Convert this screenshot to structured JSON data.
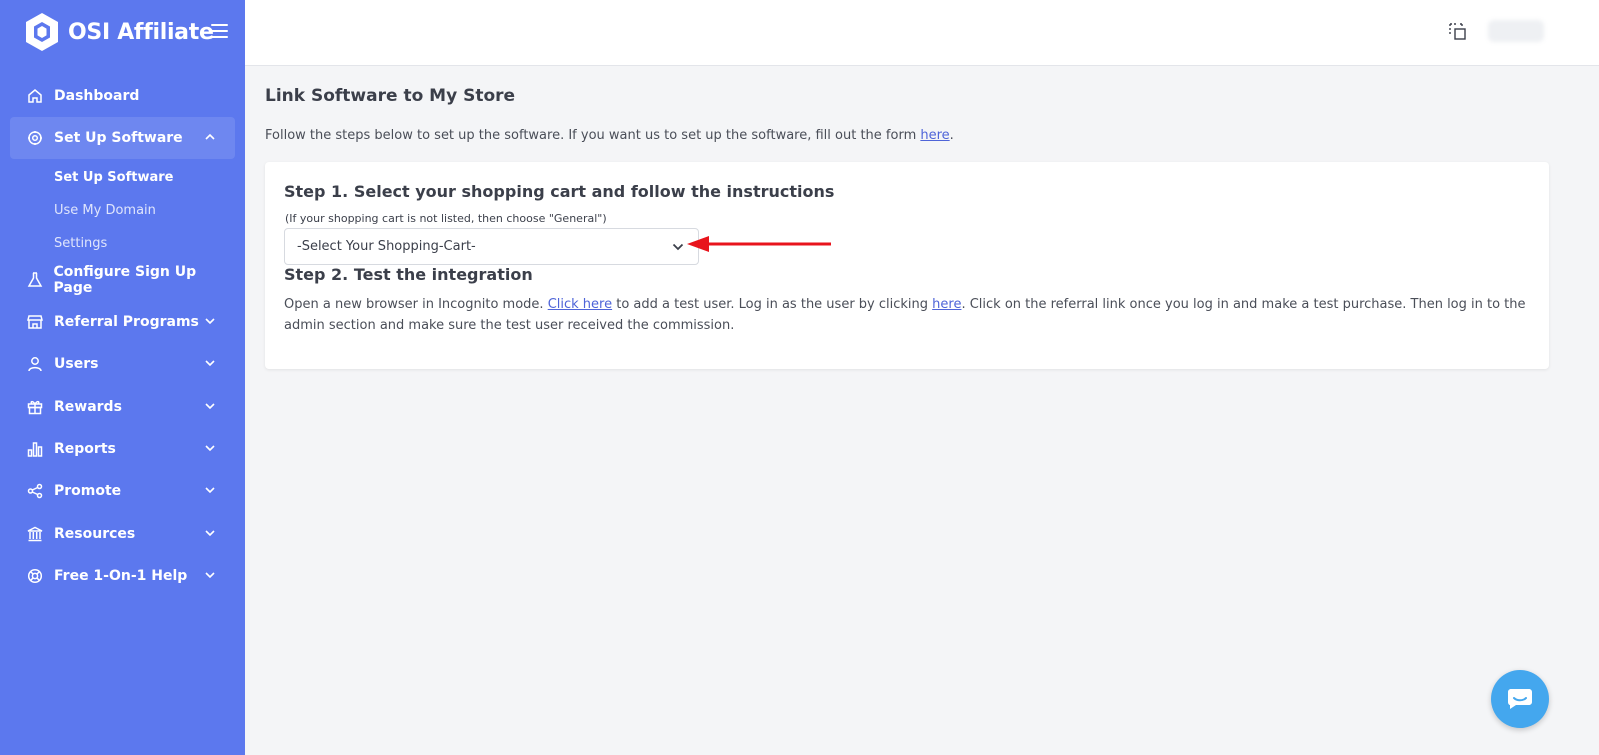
{
  "brand": {
    "name": "OSI Affiliate",
    "color": "#5c78ee"
  },
  "sidebar": {
    "items": [
      {
        "label": "Dashboard",
        "icon": "home-icon"
      },
      {
        "label": "Set Up Software",
        "icon": "gear-icon",
        "expanded": true
      },
      {
        "label": "Configure Sign Up Page",
        "icon": "flask-icon"
      },
      {
        "label": "Referral Programs",
        "icon": "store-icon"
      },
      {
        "label": "Users",
        "icon": "user-icon"
      },
      {
        "label": "Rewards",
        "icon": "gift-icon"
      },
      {
        "label": "Reports",
        "icon": "bar-chart-icon"
      },
      {
        "label": "Promote",
        "icon": "share-icon"
      },
      {
        "label": "Resources",
        "icon": "bank-icon"
      },
      {
        "label": "Free 1-On-1 Help",
        "icon": "lifebuoy-icon"
      }
    ],
    "sub_items": [
      {
        "label": "Set Up Software"
      },
      {
        "label": "Use My Domain"
      },
      {
        "label": "Settings"
      }
    ]
  },
  "main": {
    "title": "Link Software to My Store",
    "intro_text": "Follow the steps below to set up the software. If you want us to set up the software, fill out the form ",
    "intro_link": "here",
    "intro_end": ".",
    "step1": {
      "title": "Step 1. Select your shopping cart and follow the instructions",
      "note": "(If your shopping cart is not listed, then choose \"General\")",
      "select_value": "-Select Your Shopping-Cart-"
    },
    "step2": {
      "title": "Step 2. Test the integration",
      "text_a": "Open a new browser in Incognito mode. ",
      "link_a": "Click here",
      "text_b": " to add a test user. Log in as the user by clicking ",
      "link_b": "here",
      "text_c": ". Click on the referral link once you log in and make a test purchase. Then log in to the admin section and make sure the test user received the commission."
    }
  },
  "colors": {
    "sidebar_bg": "#5c78ee",
    "link": "#4e64d8",
    "annotation_arrow": "#e8141c",
    "chat_button": "#44a7ee"
  }
}
